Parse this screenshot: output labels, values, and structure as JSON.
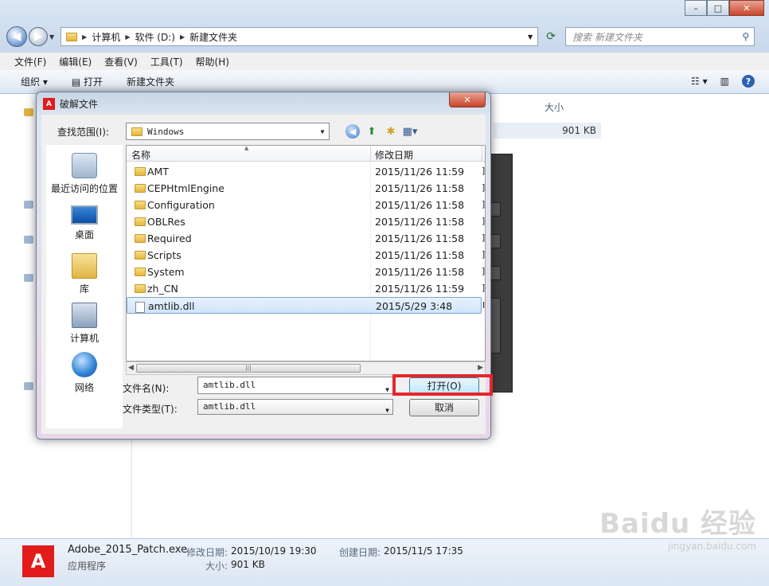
{
  "explorer": {
    "breadcrumb": [
      "计算机",
      "软件 (D:)",
      "新建文件夹"
    ],
    "search_placeholder": "搜索 新建文件夹",
    "menu": [
      "文件(F)",
      "编辑(E)",
      "查看(V)",
      "工具(T)",
      "帮助(H)"
    ],
    "toolbar": {
      "organize": "组织 ▾",
      "open": "打开",
      "new_folder": "新建文件夹"
    },
    "column_size": "大小",
    "row_size": "901 KB"
  },
  "status": {
    "file_name": "Adobe_2015_Patch.exe",
    "file_type": "应用程序",
    "modified_label": "修改日期:",
    "modified_value": "2015/10/19 19:30",
    "created_label": "创建日期:",
    "created_value": "2015/11/5 17:35",
    "size_label": "大小:",
    "size_value": "901 KB"
  },
  "dialog": {
    "title": "破解文件",
    "look_in_label": "查找范围(I):",
    "look_in_value": "Windows",
    "places": [
      "最近访问的位置",
      "桌面",
      "库",
      "计算机",
      "网络"
    ],
    "columns": {
      "name": "名称",
      "date": "修改日期"
    },
    "files": [
      {
        "name": "AMT",
        "date": "2015/11/26 11:59",
        "type": "folder"
      },
      {
        "name": "CEPHtmlEngine",
        "date": "2015/11/26 11:58",
        "type": "folder"
      },
      {
        "name": "Configuration",
        "date": "2015/11/26 11:58",
        "type": "folder"
      },
      {
        "name": "OBLRes",
        "date": "2015/11/26 11:58",
        "type": "folder"
      },
      {
        "name": "Required",
        "date": "2015/11/26 11:58",
        "type": "folder"
      },
      {
        "name": "Scripts",
        "date": "2015/11/26 11:58",
        "type": "folder"
      },
      {
        "name": "System",
        "date": "2015/11/26 11:58",
        "type": "folder"
      },
      {
        "name": "zh_CN",
        "date": "2015/11/26 11:59",
        "type": "folder"
      },
      {
        "name": "amtlib.dll",
        "date": "2015/5/29 3:48",
        "type": "file"
      }
    ],
    "file_name_label": "文件名(N):",
    "file_name_value": "amtlib.dll",
    "file_type_label": "文件类型(T):",
    "file_type_value": "amtlib.dll",
    "open_label": "打开(O)",
    "cancel_label": "取消"
  },
  "watermark": {
    "logo": "Baidu 经验",
    "url": "jingyan.baidu.com"
  },
  "colors": {
    "highlight": "#e5262b",
    "adobe_red": "#e21b1b",
    "selection": "#cfe4fb"
  }
}
